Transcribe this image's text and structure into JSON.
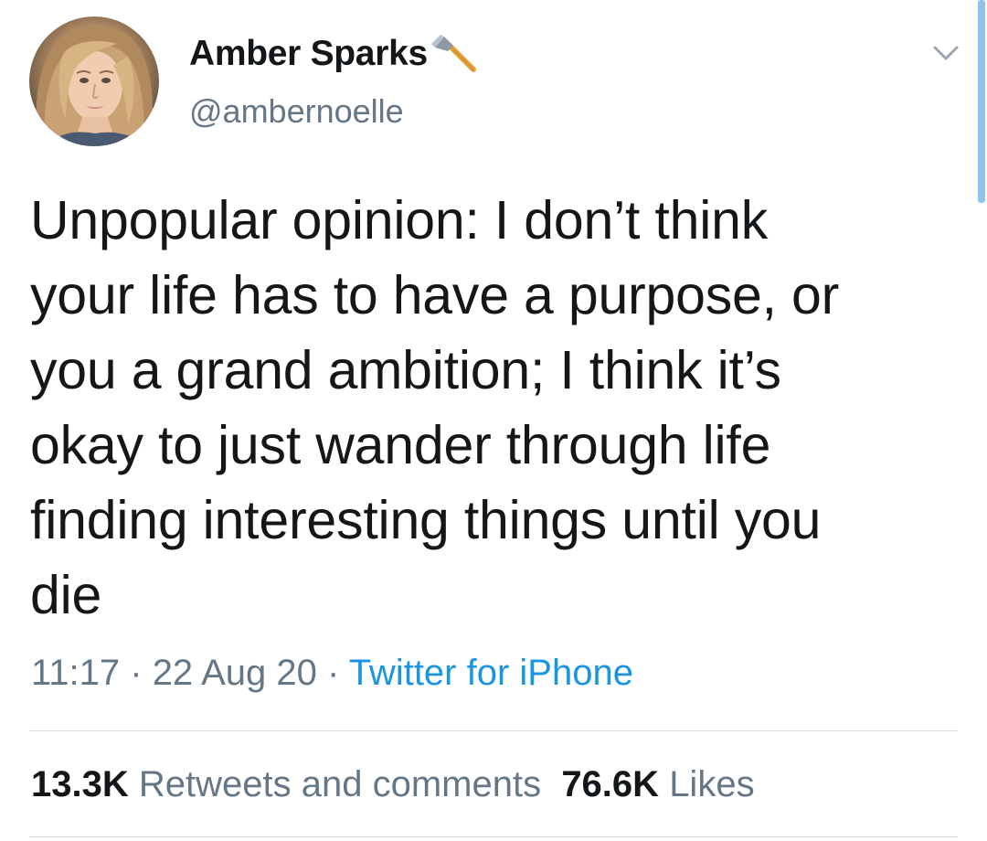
{
  "author": {
    "display_name": "Amber Sparks",
    "handle": "@ambernoelle",
    "name_emoji": "axe-icon"
  },
  "tweet": {
    "text": "Unpopular opinion: I don’t think\nyour life has to have a purpose, or\nyou a grand ambition; I think it’s\nokay to just wander through life\nfinding interesting things until you\ndie"
  },
  "meta": {
    "time": "11:17",
    "separator1": " · ",
    "date": "22 Aug 20",
    "separator2": " · ",
    "source": "Twitter for iPhone"
  },
  "stats": {
    "retweets_count": "13.3K",
    "retweets_label": "Retweets and comments",
    "likes_count": "76.6K",
    "likes_label": "Likes"
  },
  "colors": {
    "text_primary": "#14171a",
    "text_secondary": "#657786",
    "link": "#1b95e0",
    "divider": "#d9dee2",
    "scroll_indicator": "#8fc4ee"
  },
  "icons": {
    "menu": "chevron-down-icon",
    "avatar": "avatar"
  }
}
